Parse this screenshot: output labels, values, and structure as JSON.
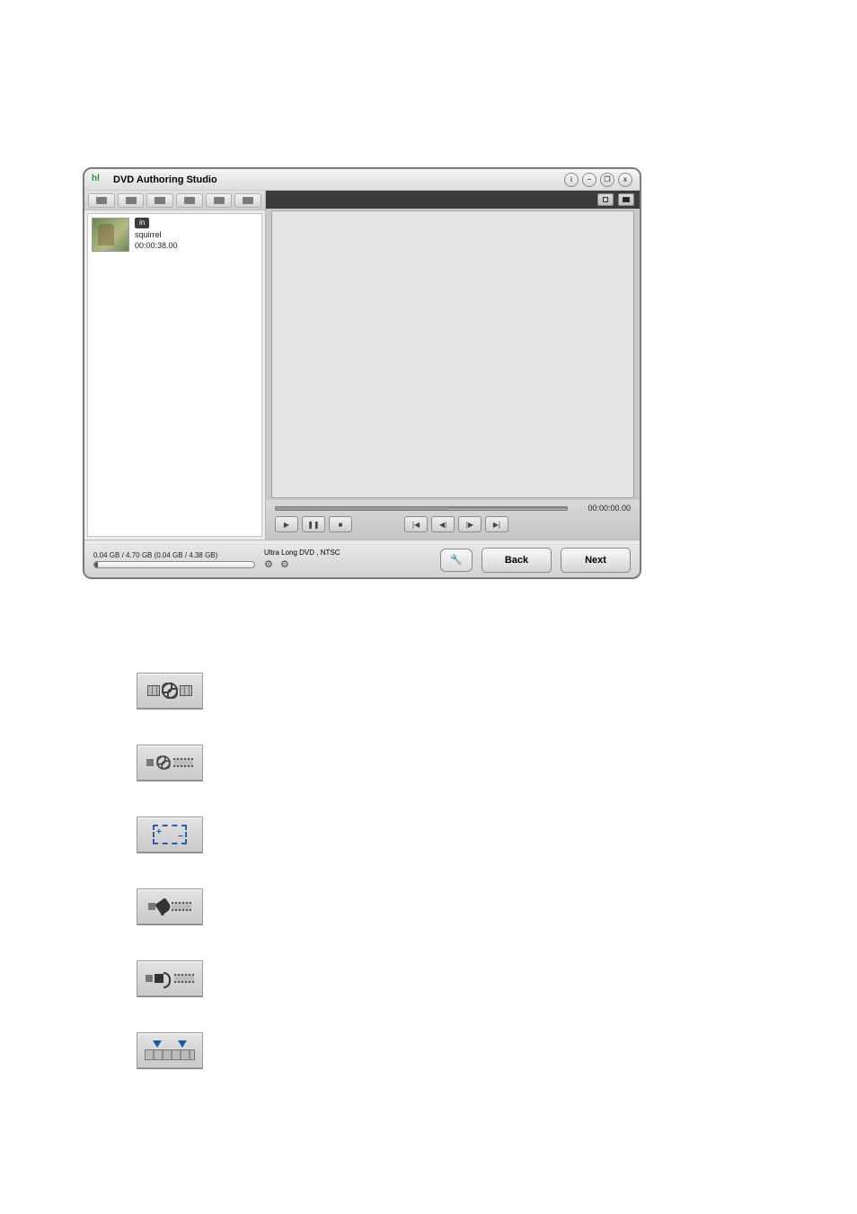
{
  "titlebar": {
    "logo_text": "hl",
    "app_title": "DVD Authoring Studio",
    "btn_info": "i",
    "btn_min": "–",
    "btn_max": "❐",
    "btn_close": "x"
  },
  "left_panel": {
    "clip": {
      "badge": "in",
      "name": "squirrel",
      "duration": "00:00:38.00"
    }
  },
  "preview": {
    "timecode": "00:00:00.00",
    "play": "▶",
    "pause": "❚❚",
    "stop": "■",
    "skip_start": "|◀",
    "step_back": "◀|",
    "step_fwd": "|▶",
    "skip_end": "▶|"
  },
  "bottom": {
    "capacity_text": "0.04 GB / 4.70 GB (0.04 GB / 4.38 GB)",
    "mode_text": "Ultra Long DVD , NTSC",
    "back_label": "Back",
    "next_label": "Next",
    "wrench_glyph": "🔧",
    "gear_glyph_a": "⚙",
    "gear_glyph_b": "⚙"
  },
  "swatches": {
    "sw3_plus": "+",
    "sw3_minus": "−"
  }
}
